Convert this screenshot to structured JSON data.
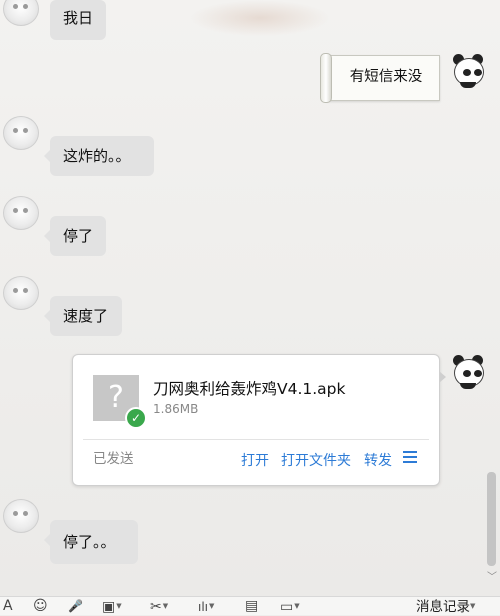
{
  "messages": {
    "m1": "我日",
    "m2_sent": "有短信来没",
    "m3": "这炸的。。",
    "m4": "停了",
    "m5": "速度了",
    "m6": "停了。。"
  },
  "file": {
    "name": "刀网奥利给轰炸鸡V4.1.apk",
    "size": "1.86MB",
    "status": "已发送",
    "thumb_glyph": "?",
    "check_glyph": "✓",
    "actions": {
      "open": "打开",
      "open_folder": "打开文件夹",
      "forward": "转发"
    }
  },
  "toolbar": {
    "font_glyph": "A",
    "emoji_glyph": "☺",
    "mic_glyph": "🎤",
    "image_glyph": "▣",
    "scissors_glyph": "✂",
    "chart_glyph": "ılı",
    "gift_glyph": "▤",
    "more_glyph": "▭",
    "history_label": "消息记录",
    "caret": "▼"
  },
  "scroll_down_glyph": "﹀",
  "colors": {
    "accent_link": "#2d7bd6",
    "bubble_bg": "#e2e2e2",
    "sent_check": "#3aa84c"
  }
}
